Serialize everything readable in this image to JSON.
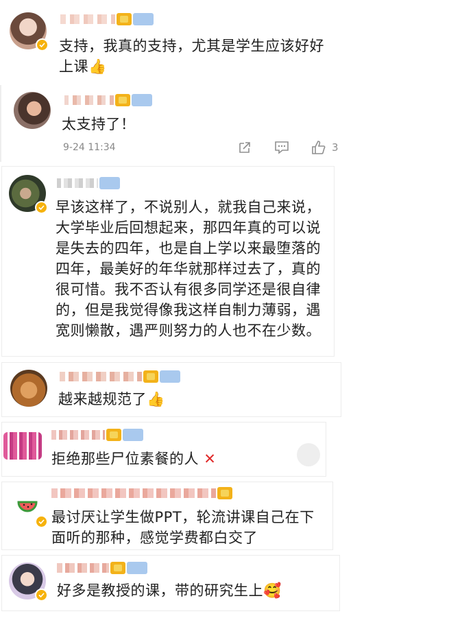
{
  "comments": [
    {
      "id": "c1",
      "text": "支持，我真的支持，尤其是学生应该好好上课",
      "emoji": "thumbs-up"
    },
    {
      "id": "c2",
      "text": "太支持了！",
      "time": "9-24 11:34",
      "likes": "3"
    },
    {
      "id": "c3",
      "text": "早该这样了，不说别人，就我自己来说，大学毕业后回想起来，那四年真的可以说是失去的四年，也是自上学以来最堕落的四年，最美好的年华就那样过去了，真的很可惜。我不否认有很多同学还是很自律的，但是我觉得像我这样自制力薄弱，遇宽则懒散，遇严则努力的人也不在少数。"
    },
    {
      "id": "c4",
      "text": "越来越规范了",
      "emoji": "thumbs-up"
    },
    {
      "id": "c5",
      "text": "拒绝那些尸位素餐的人",
      "emoji": "cross-mark"
    },
    {
      "id": "c6",
      "text": "最讨厌让学生做PPT，轮流讲课自己在下面听的那种，感觉学费都白交了"
    },
    {
      "id": "c7",
      "text": "好多是教授的课，带的研究生上",
      "emoji": "smiling-face"
    }
  ],
  "colors": {
    "verified_badge": "#f6b20c",
    "text": "#222222",
    "meta": "#888888"
  }
}
